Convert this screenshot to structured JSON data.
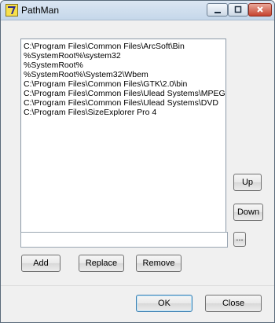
{
  "window": {
    "title": "PathMan"
  },
  "paths": [
    "C:\\Program Files\\Common Files\\ArcSoft\\Bin",
    "%SystemRoot%\\system32",
    "%SystemRoot%",
    "%SystemRoot%\\System32\\Wbem",
    "C:\\Program Files\\Common Files\\GTK\\2.0\\bin",
    "C:\\Program Files\\Common Files\\Ulead Systems\\MPEG",
    "C:\\Program Files\\Common Files\\Ulead Systems\\DVD",
    "C:\\Program Files\\SizeExplorer Pro 4"
  ],
  "buttons": {
    "up": "Up",
    "down": "Down",
    "browse": "...",
    "add": "Add",
    "replace": "Replace",
    "remove": "Remove",
    "ok": "OK",
    "close": "Close"
  },
  "edit": {
    "value": ""
  }
}
